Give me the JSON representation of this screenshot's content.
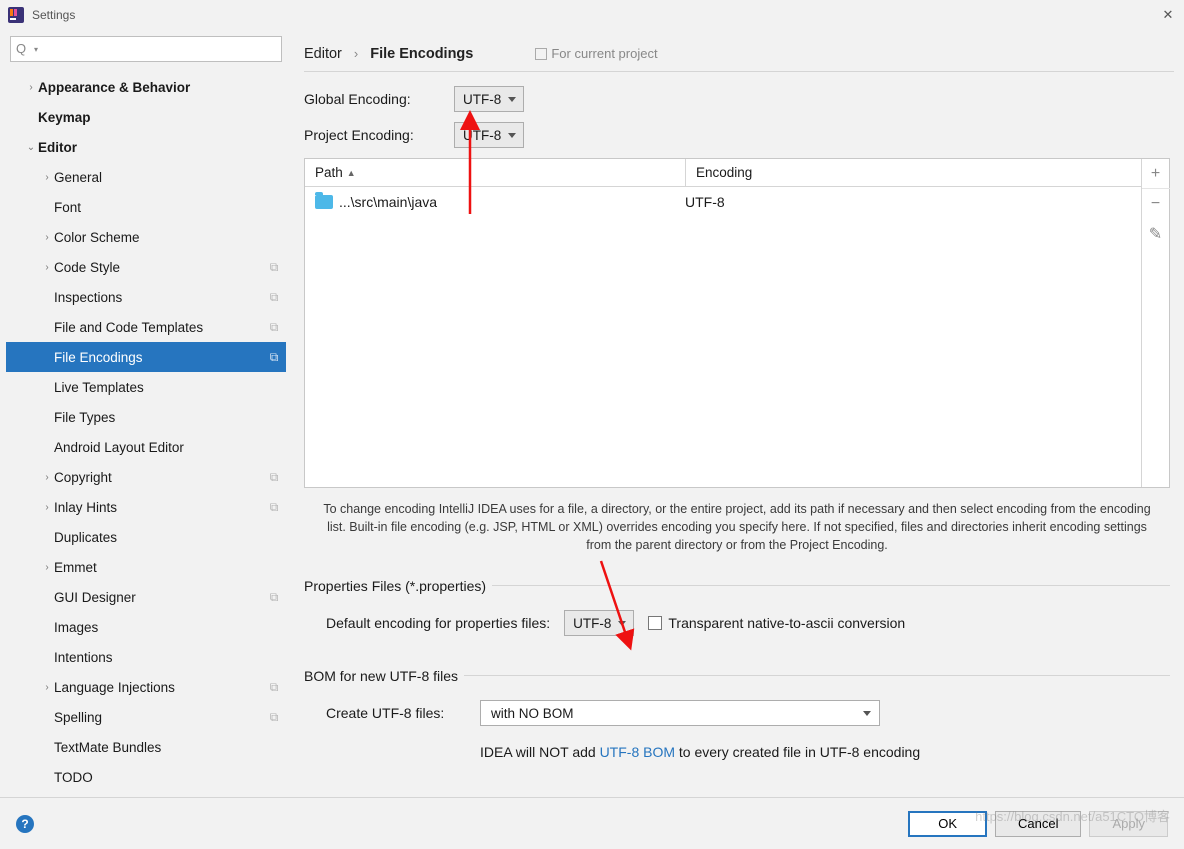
{
  "window": {
    "title": "Settings"
  },
  "search": {
    "placeholder": ""
  },
  "tree": [
    {
      "label": "Appearance & Behavior",
      "indent": 0,
      "arrow": "›",
      "bold": true
    },
    {
      "label": "Keymap",
      "indent": 0,
      "arrow": "",
      "bold": true
    },
    {
      "label": "Editor",
      "indent": 0,
      "arrow": "⌄",
      "bold": true
    },
    {
      "label": "General",
      "indent": 1,
      "arrow": "›"
    },
    {
      "label": "Font",
      "indent": 1,
      "arrow": ""
    },
    {
      "label": "Color Scheme",
      "indent": 1,
      "arrow": "›"
    },
    {
      "label": "Code Style",
      "indent": 1,
      "arrow": "›",
      "copy": true
    },
    {
      "label": "Inspections",
      "indent": 1,
      "arrow": "",
      "copy": true
    },
    {
      "label": "File and Code Templates",
      "indent": 1,
      "arrow": "",
      "copy": true
    },
    {
      "label": "File Encodings",
      "indent": 1,
      "arrow": "",
      "copy": true,
      "selected": true
    },
    {
      "label": "Live Templates",
      "indent": 1,
      "arrow": ""
    },
    {
      "label": "File Types",
      "indent": 1,
      "arrow": ""
    },
    {
      "label": "Android Layout Editor",
      "indent": 1,
      "arrow": ""
    },
    {
      "label": "Copyright",
      "indent": 1,
      "arrow": "›",
      "copy": true
    },
    {
      "label": "Inlay Hints",
      "indent": 1,
      "arrow": "›",
      "copy": true
    },
    {
      "label": "Duplicates",
      "indent": 1,
      "arrow": ""
    },
    {
      "label": "Emmet",
      "indent": 1,
      "arrow": "›"
    },
    {
      "label": "GUI Designer",
      "indent": 1,
      "arrow": "",
      "copy": true
    },
    {
      "label": "Images",
      "indent": 1,
      "arrow": ""
    },
    {
      "label": "Intentions",
      "indent": 1,
      "arrow": ""
    },
    {
      "label": "Language Injections",
      "indent": 1,
      "arrow": "›",
      "copy": true
    },
    {
      "label": "Spelling",
      "indent": 1,
      "arrow": "",
      "copy": true
    },
    {
      "label": "TextMate Bundles",
      "indent": 1,
      "arrow": ""
    },
    {
      "label": "TODO",
      "indent": 1,
      "arrow": ""
    }
  ],
  "breadcrumb": {
    "a": "Editor",
    "b": "File Encodings",
    "scope": "For current project"
  },
  "globalEncoding": {
    "label": "Global Encoding:",
    "value": "UTF-8"
  },
  "projectEncoding": {
    "label": "Project Encoding:",
    "value": "UTF-8"
  },
  "table": {
    "col1": "Path",
    "col2": "Encoding",
    "row": {
      "path": "...\\src\\main\\java",
      "enc": "UTF-8"
    }
  },
  "helpText": "To change encoding IntelliJ IDEA uses for a file, a directory, or the entire project, add its path if necessary and then select encoding from the encoding list. Built-in file encoding (e.g. JSP, HTML or XML) overrides encoding you specify here. If not specified, files and directories inherit encoding settings from the parent directory or from the Project Encoding.",
  "props": {
    "heading": "Properties Files (*.properties)",
    "label": "Default encoding for properties files:",
    "value": "UTF-8",
    "chk": "Transparent native-to-ascii conversion"
  },
  "bom": {
    "heading": "BOM for new UTF-8 files",
    "label": "Create UTF-8 files:",
    "value": "with NO BOM",
    "note1": "IDEA will NOT add ",
    "link": "UTF-8 BOM",
    "note2": " to every created file in UTF-8 encoding"
  },
  "buttons": {
    "ok": "OK",
    "cancel": "Cancel",
    "apply": "Apply"
  },
  "watermark": "https://blog.csdn.net/a51CTO博客"
}
